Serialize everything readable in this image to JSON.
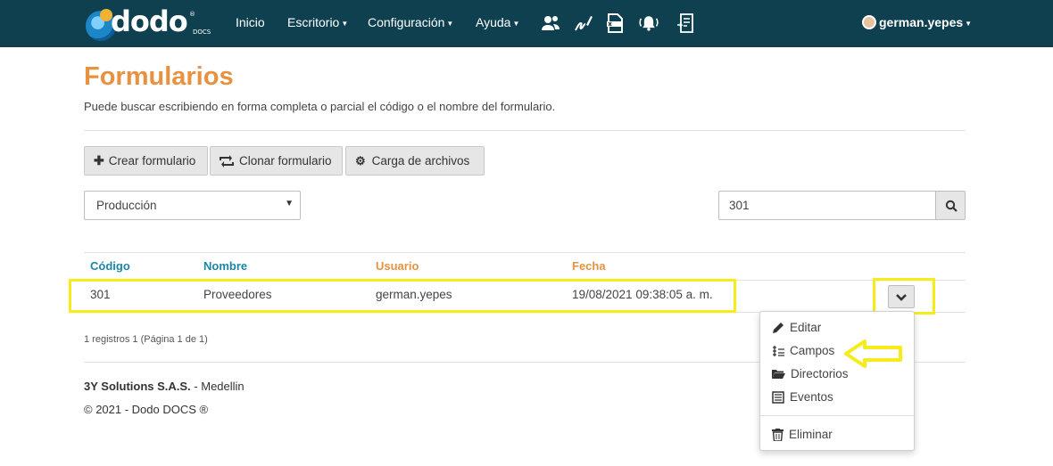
{
  "brand": {
    "name": "dodo",
    "sub": "DOCS",
    "reg": "®"
  },
  "nav": {
    "items": [
      {
        "label": "Inicio",
        "dropdown": false
      },
      {
        "label": "Escritorio",
        "dropdown": true
      },
      {
        "label": "Configuración",
        "dropdown": true
      },
      {
        "label": "Ayuda",
        "dropdown": true
      }
    ],
    "icons": [
      "users-icon",
      "signature-icon",
      "xlsx-file-icon",
      "bell-icon",
      "document-list-icon"
    ],
    "user": "german.yepes"
  },
  "page": {
    "title": "Formularios",
    "subtitle": "Puede buscar escribiendo en forma completa o parcial el código o el nombre del formulario."
  },
  "toolbar": {
    "create_label": "Crear formulario",
    "clone_label": "Clonar formulario",
    "upload_label": "Carga de archivos"
  },
  "filters": {
    "environment_selected": "Producción",
    "search_value": "301"
  },
  "table": {
    "headers": {
      "code": "Código",
      "name": "Nombre",
      "user": "Usuario",
      "date": "Fecha"
    },
    "rows": [
      {
        "code": "301",
        "name": "Proveedores",
        "user": "german.yepes",
        "date": "19/08/2021 09:38:05 a. m."
      }
    ],
    "summary": "1 registros 1 (Página 1 de 1)"
  },
  "row_menu": {
    "items": [
      "Editar",
      "Campos",
      "Directorios",
      "Eventos"
    ],
    "danger_item": "Eliminar"
  },
  "footer": {
    "company": "3Y Solutions S.A.S.",
    "city": " - Medellin",
    "copyright": "© 2021 - Dodo DOCS ®"
  },
  "colors": {
    "navbar": "#0f4050",
    "title": "#e69240",
    "header_blue": "#1b86a8",
    "header_orange": "#e69240",
    "annotation": "#f5ec1a"
  }
}
